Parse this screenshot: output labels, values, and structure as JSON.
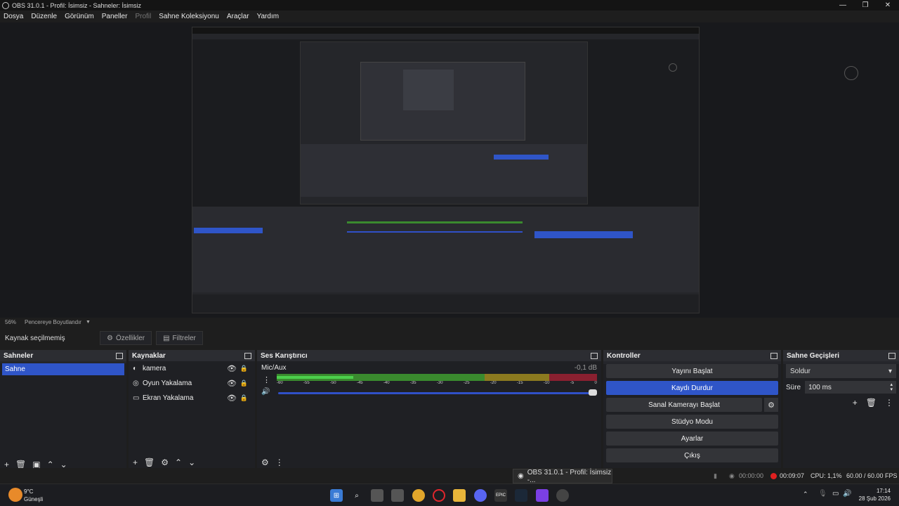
{
  "window": {
    "title": "OBS 31.0.1 - Profil: İsimsiz - Sahneler: İsimsiz",
    "min": "—",
    "max": "❐",
    "close": "✕"
  },
  "menu": [
    "Dosya",
    "Düzenle",
    "Görünüm",
    "Paneller",
    "Profil",
    "Sahne Koleksiyonu",
    "Araçlar",
    "Yardım"
  ],
  "zoom": {
    "level": "56%",
    "label": "Pencereye Boyutlandır"
  },
  "properties_bar": {
    "selection": "Kaynak seçilmemiş",
    "properties": "Özellikler",
    "filters": "Filtreler"
  },
  "scenes": {
    "title": "Sahneler",
    "items": [
      "Sahne"
    ]
  },
  "sources": {
    "title": "Kaynaklar",
    "items": [
      "kamera",
      "Oyun Yakalama",
      "Ekran Yakalama"
    ]
  },
  "mixer": {
    "title": "Ses Karıştırıcı",
    "channel": "Mic/Aux",
    "db": "-0,1 dB",
    "level_fraction": 0.24,
    "volume_fraction": 1.0,
    "ticks": [
      "-60",
      "-55",
      "-50",
      "-45",
      "-40",
      "-35",
      "-30",
      "-25",
      "-20",
      "-15",
      "-10",
      "-5",
      "0"
    ]
  },
  "controls": {
    "title": "Kontroller",
    "start_stream": "Yayını Başlat",
    "stop_record": "Kaydı Durdur",
    "virtual_cam": "Sanal Kamerayı Başlat",
    "studio_mode": "Stüdyo Modu",
    "settings": "Ayarlar",
    "exit": "Çıkış"
  },
  "transitions": {
    "title": "Sahne Geçişleri",
    "selected": "Soldur",
    "duration_label": "Süre",
    "duration": "100 ms"
  },
  "status": {
    "stream_time": "00:00:00",
    "rec_time": "00:09:07",
    "cpu": "CPU: 1,1%",
    "fps": "60.00 / 60.00 FPS"
  },
  "popup": "OBS 31.0.1 - Profil: İsimsiz -...",
  "taskbar": {
    "temp": "9°C",
    "weather": "Güneşli",
    "time": "17:14",
    "date": "28 Şub 2026"
  },
  "colors": {
    "accent": "#2f55c8",
    "rec": "#e02020",
    "meter_green": "#4cd04c"
  }
}
